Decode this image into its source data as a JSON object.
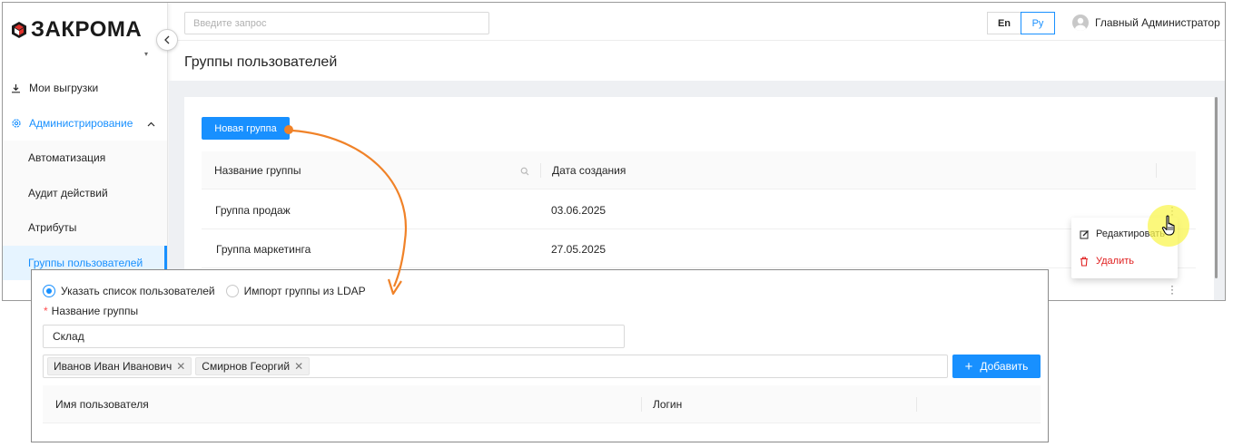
{
  "brand": {
    "logo_text": "ЗАКРОМА"
  },
  "header": {
    "search_placeholder": "Введите запрос",
    "lang_en": "En",
    "lang_ru": "Ру",
    "user_name": "Главный Администратор"
  },
  "sidebar": {
    "items": [
      {
        "label": "Мои выгрузки",
        "icon": "download-icon"
      },
      {
        "label": "Администрирование",
        "icon": "gear-icon"
      }
    ],
    "submenu": [
      {
        "label": "Автоматизация"
      },
      {
        "label": "Аудит действий"
      },
      {
        "label": "Атрибуты"
      },
      {
        "label": "Группы пользователей",
        "active": true
      }
    ]
  },
  "page": {
    "title": "Группы пользователей",
    "new_group_button": "Новая группа",
    "columns": [
      "Название группы",
      "Дата создания"
    ],
    "rows": [
      {
        "name": "Группа продаж",
        "date": "03.06.2025"
      },
      {
        "name": "Группа маркетинга",
        "date": "27.05.2025"
      }
    ]
  },
  "dropdown": {
    "edit": "Редактировать",
    "delete": "Удалить"
  },
  "form": {
    "radio_manual": "Указать список пользователей",
    "radio_ldap": "Импорт группы из LDAP",
    "name_label": "Название группы",
    "required_mark": "*",
    "name_value": "Склад",
    "tags": [
      "Иванов Иван Иванович",
      "Смирнов Георгий"
    ],
    "add_button": "Добавить",
    "columns": [
      "Имя пользователя",
      "Логин"
    ]
  },
  "colors": {
    "accent": "#1890ff",
    "danger": "#e02020",
    "arrow": "#f08228",
    "highlight": "#faf550"
  }
}
